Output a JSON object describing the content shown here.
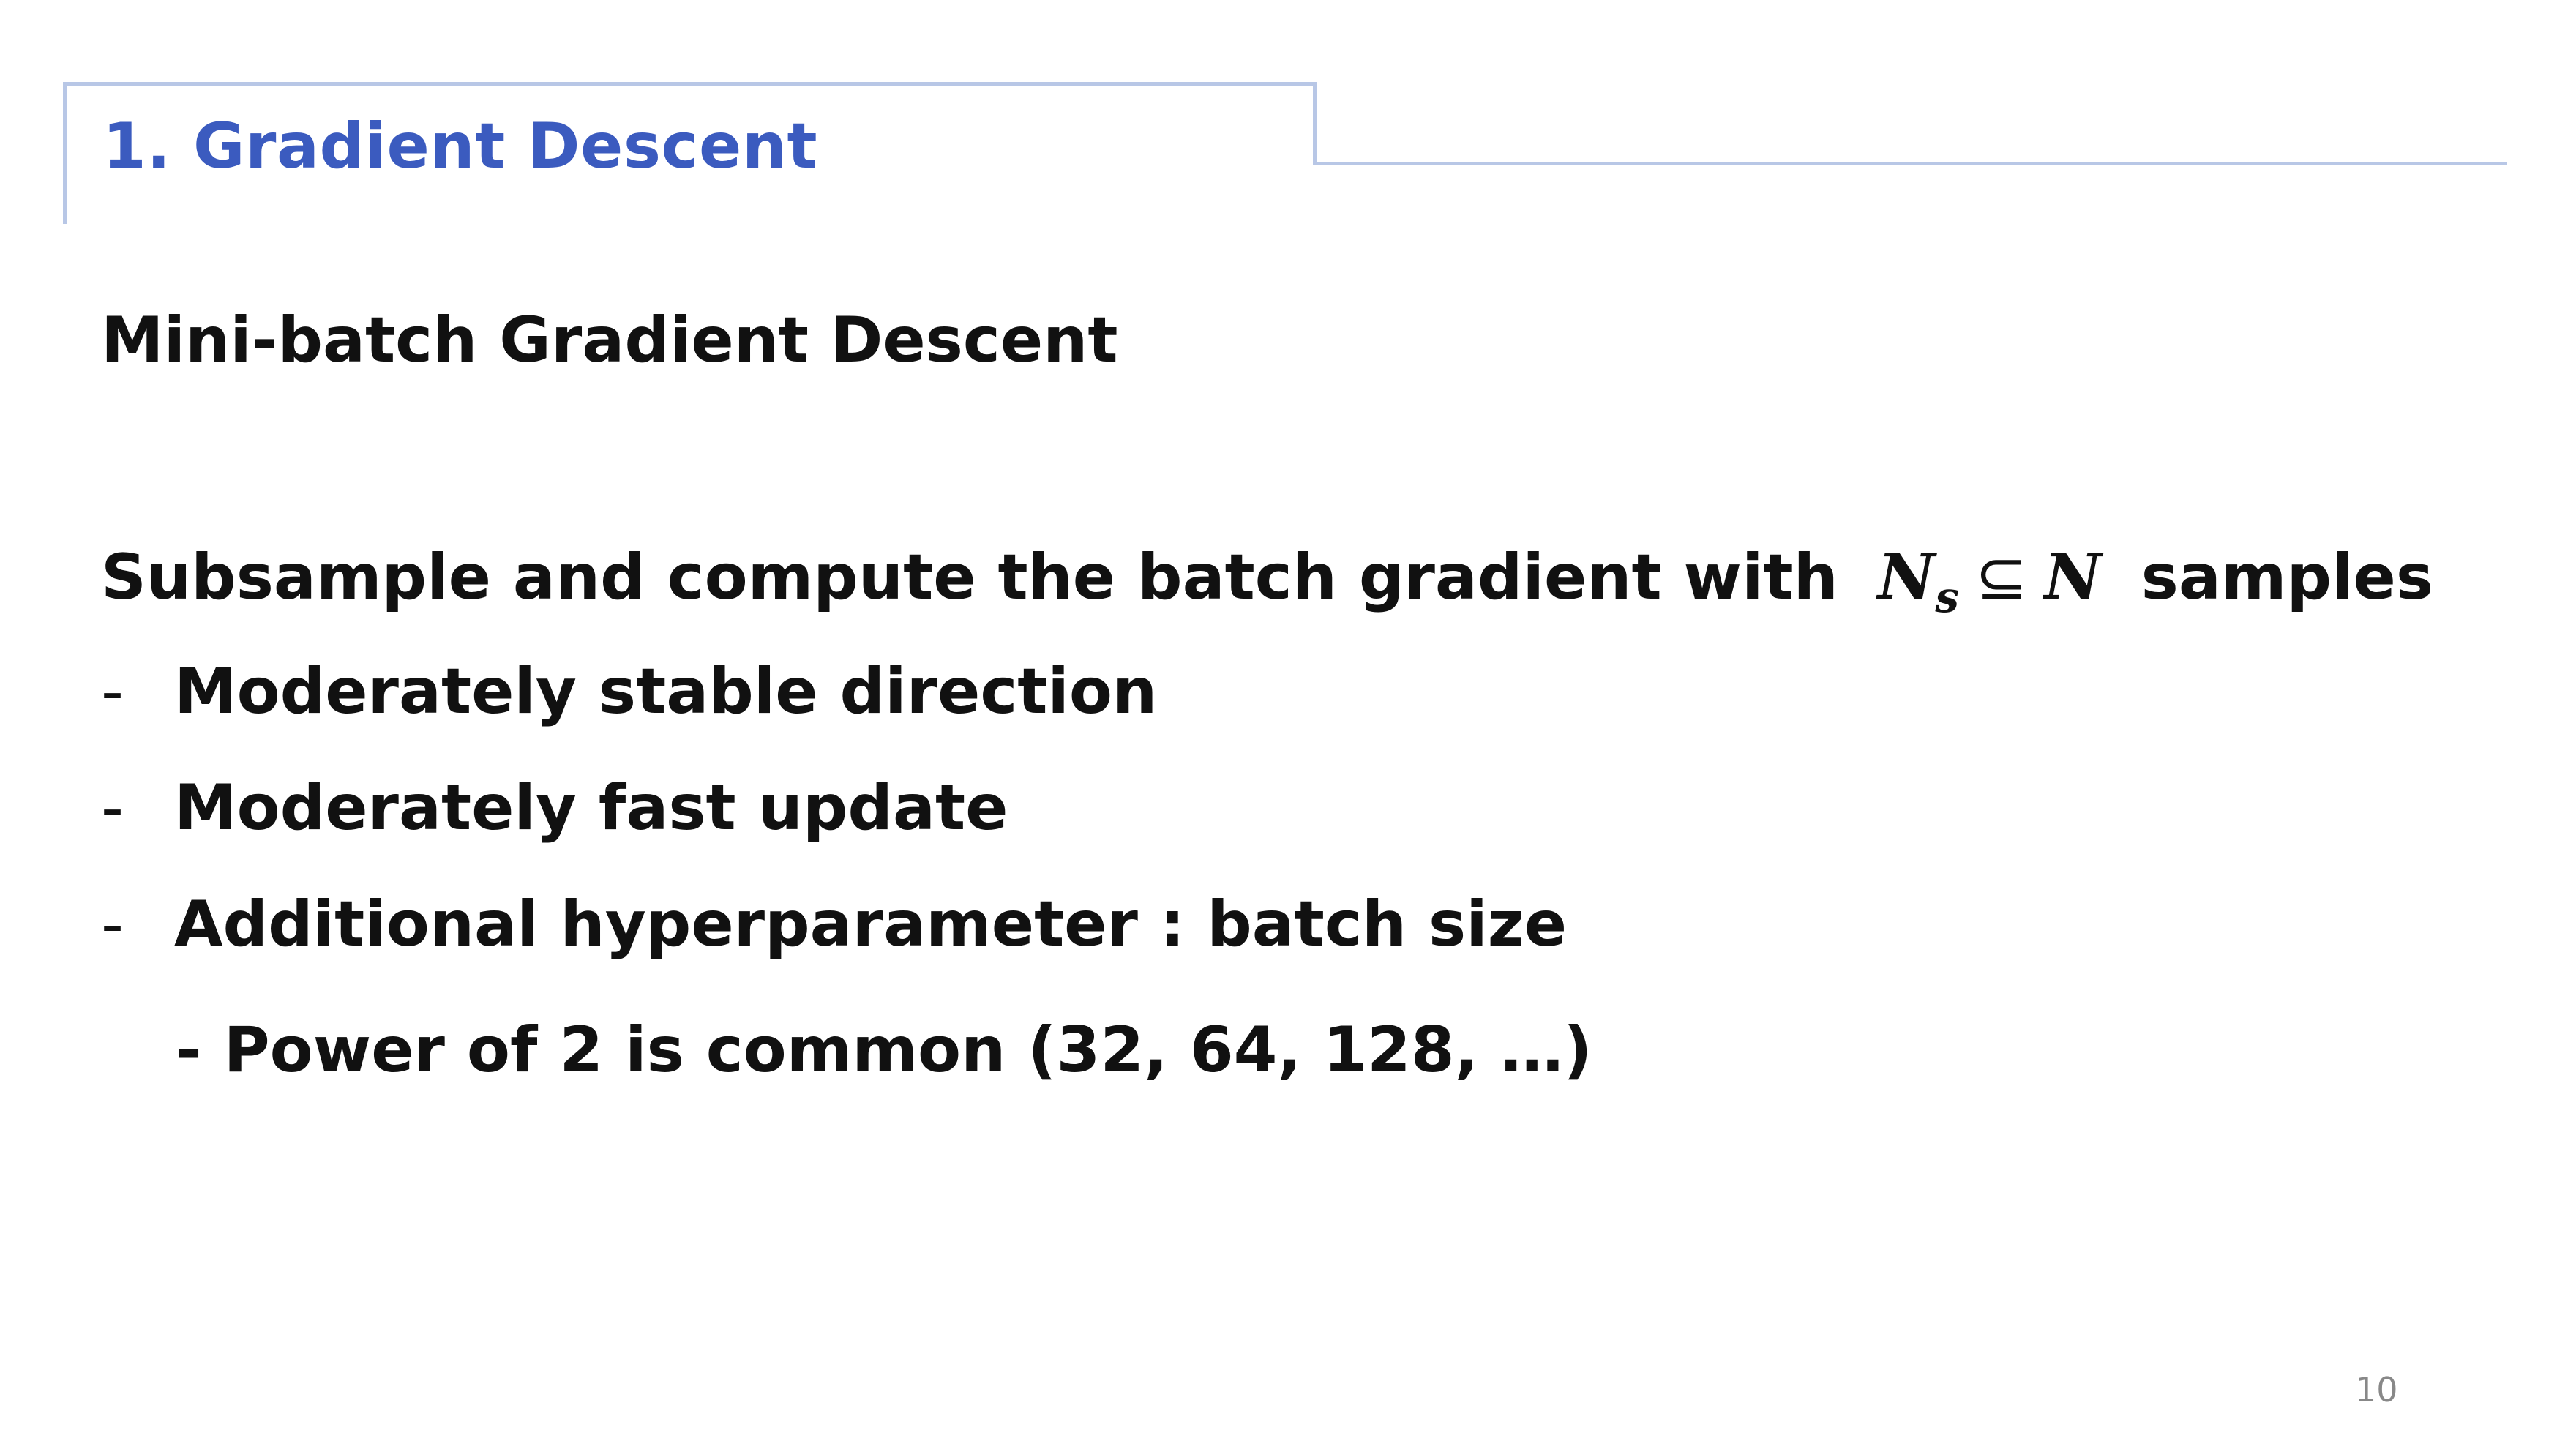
{
  "slide": {
    "title": "1. Gradient Descent",
    "subtitle": "Mini-batch Gradient Descent",
    "main_text_before": "Subsample and compute the batch gradient with",
    "math": {
      "var": "N",
      "sub": "s",
      "op": "⊆",
      "var2": "N"
    },
    "main_text_after": "samples",
    "bullet_dash": "-",
    "bullets": [
      "Moderately stable direction",
      "Moderately fast update",
      "Additional hyperparameter : batch size"
    ],
    "sub_bullet": "- Power of 2 is common (32, 64, 128, …)",
    "page_number": "10"
  },
  "colors": {
    "title": "#3b5bbf",
    "frame": "#b8c7e6",
    "text": "#111111",
    "page_number": "#888888"
  }
}
